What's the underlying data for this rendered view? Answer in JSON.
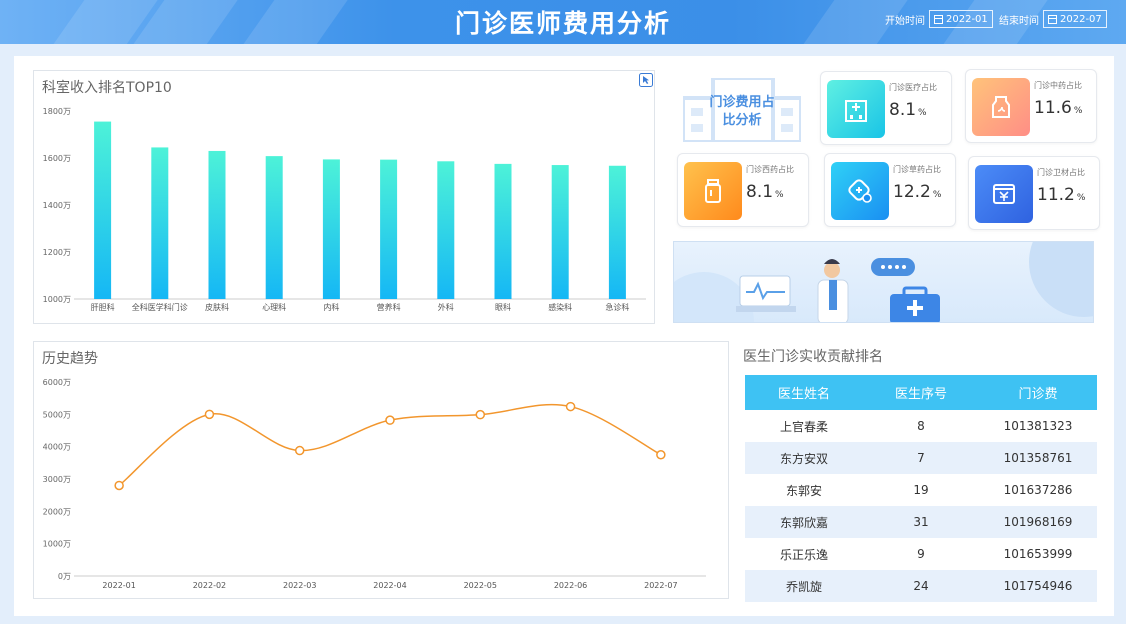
{
  "header": {
    "title": "门诊医师费用分析",
    "start_label": "开始时间",
    "start_value": "2022-01",
    "end_label": "结束时间",
    "end_value": "2022-07"
  },
  "income_rank": {
    "title": "科室收入排名TOP10",
    "chart_data": {
      "type": "bar",
      "categories": [
        "肝胆科",
        "全科医学科门诊",
        "皮肤科",
        "心理科",
        "内科",
        "营养科",
        "外科",
        "眼科",
        "感染科",
        "急诊科"
      ],
      "values": [
        1755,
        1645,
        1630,
        1608,
        1594,
        1593,
        1586,
        1575,
        1570,
        1567
      ],
      "yticks": [
        "1000万",
        "1200万",
        "1400万",
        "1600万",
        "1800万"
      ],
      "ylim": [
        1000,
        1800
      ],
      "colors": [
        "#4df2d8",
        "#15b7f5"
      ]
    }
  },
  "share": {
    "hero": "门诊费用占比分析",
    "cards": [
      {
        "label": "门诊医疗占比",
        "value": "8.1",
        "unit": "%",
        "icon": "hospital-icon"
      },
      {
        "label": "门诊中药占比",
        "value": "11.6",
        "unit": "%",
        "icon": "herb-bottle-icon"
      },
      {
        "label": "门诊西药占比",
        "value": "8.1",
        "unit": "%",
        "icon": "medicine-bottle-icon"
      },
      {
        "label": "门诊草药占比",
        "value": "12.2",
        "unit": "%",
        "icon": "pill-icon"
      },
      {
        "label": "门诊卫材占比",
        "value": "11.2",
        "unit": "%",
        "icon": "cash-register-icon"
      }
    ]
  },
  "history": {
    "title": "历史趋势",
    "chart_data": {
      "type": "line",
      "x": [
        "2022-01",
        "2022-02",
        "2022-03",
        "2022-04",
        "2022-05",
        "2022-06",
        "2022-07"
      ],
      "values": [
        2800,
        5000,
        3880,
        4820,
        4990,
        5240,
        3750
      ],
      "yticks": [
        "0万",
        "1000万",
        "2000万",
        "3000万",
        "4000万",
        "5000万",
        "6000万"
      ],
      "ylim": [
        0,
        6000
      ],
      "color": "#f2962d"
    }
  },
  "doctor_rank": {
    "title": "医生门诊实收贡献排名",
    "columns": [
      "医生姓名",
      "医生序号",
      "门诊费"
    ],
    "rows": [
      [
        "上官春柔",
        "8",
        "101381323"
      ],
      [
        "东方安双",
        "7",
        "101358761"
      ],
      [
        "东郭安",
        "19",
        "101637286"
      ],
      [
        "东郭欣嘉",
        "31",
        "101968169"
      ],
      [
        "乐正乐逸",
        "9",
        "101653999"
      ],
      [
        "乔凯旋",
        "24",
        "101754946"
      ]
    ]
  }
}
